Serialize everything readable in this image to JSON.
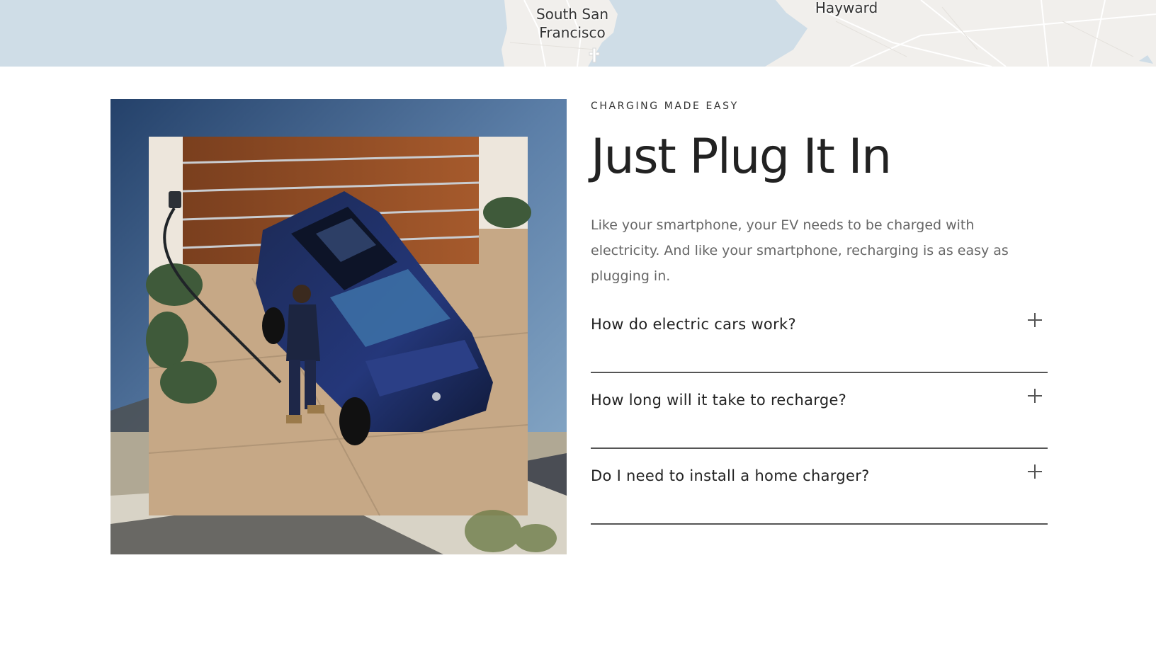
{
  "map": {
    "labels": [
      "South San Francisco",
      "Hayward"
    ],
    "label_ssf_line1": "South San",
    "label_ssf_line2": "Francisco",
    "label_hayward": "Hayward"
  },
  "section": {
    "eyebrow": "CHARGING MADE EASY",
    "headline": "Just Plug It In",
    "lead": "Like your smartphone, your EV needs to be charged with electricity. And like your smartphone, recharging is as easy as plugging in.",
    "image_description_icon": "ev-charging-photo"
  },
  "faq": [
    {
      "question": "How do electric cars work?",
      "icon": "plus-icon"
    },
    {
      "question": "How long will it take to recharge?",
      "icon": "plus-icon"
    },
    {
      "question": "Do I need to install a home charger?",
      "icon": "plus-icon"
    }
  ],
  "colors": {
    "map_water": "#cfdde7",
    "map_land": "#f1efec",
    "divider": "#555555",
    "body_text": "#666666",
    "heading_text": "#222222"
  }
}
